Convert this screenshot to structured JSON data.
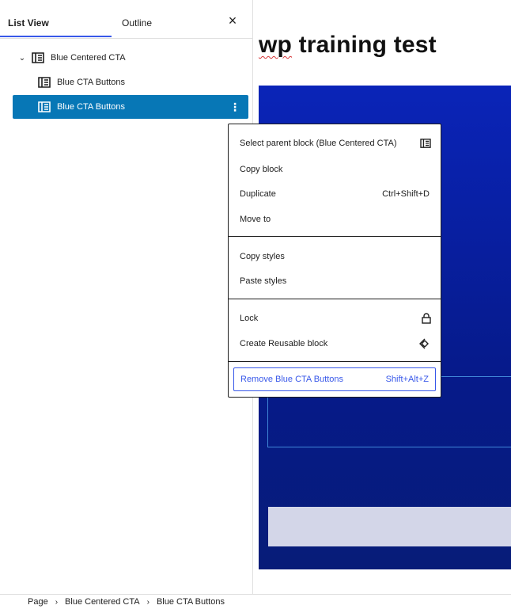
{
  "sidebar": {
    "tabs": {
      "list_view": "List View",
      "outline": "Outline"
    },
    "close_label": "×",
    "tree": [
      {
        "label": "Blue Centered CTA"
      },
      {
        "label": "Blue CTA Buttons"
      },
      {
        "label": "Blue CTA Buttons",
        "selected": true
      }
    ],
    "kebab": "⋮"
  },
  "editor": {
    "title_word1": "wp",
    "title_rest": " training test",
    "accent_color": "#0a24b8"
  },
  "menu": {
    "group1": [
      {
        "label": "Select parent block (Blue Centered CTA)",
        "icon": "block-icon"
      },
      {
        "label": "Copy block"
      },
      {
        "label": "Duplicate",
        "shortcut": "Ctrl+Shift+D"
      },
      {
        "label": "Move to"
      }
    ],
    "group2": [
      {
        "label": "Copy styles"
      },
      {
        "label": "Paste styles"
      }
    ],
    "group3": [
      {
        "label": "Lock",
        "icon": "lock-icon"
      },
      {
        "label": "Create Reusable block",
        "icon": "reusable-icon"
      }
    ],
    "remove": {
      "label": "Remove Blue CTA Buttons",
      "shortcut": "Shift+Alt+Z"
    }
  },
  "breadcrumb": [
    "Page",
    "Blue Centered CTA",
    "Blue CTA Buttons"
  ],
  "colors": {
    "selection": "#0777b6",
    "wp_admin_blue": "#3858e9",
    "cta_blue": "#0a24b8"
  }
}
